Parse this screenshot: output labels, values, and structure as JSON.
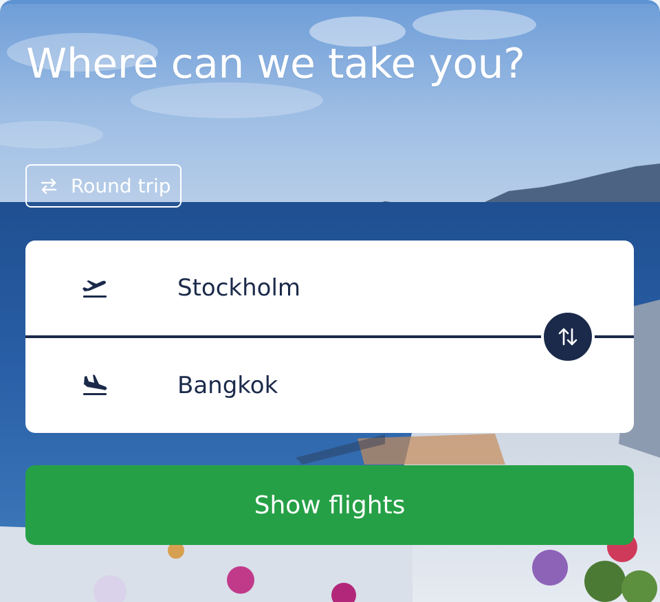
{
  "hero": {
    "title": "Where can we take you?"
  },
  "trip_type": {
    "label": "Round trip",
    "icon": "swap-horizontal-icon"
  },
  "route": {
    "origin": {
      "value": "Stockholm",
      "icon": "plane-departure-icon"
    },
    "destination": {
      "value": "Bangkok",
      "icon": "plane-arrival-icon"
    },
    "swap_icon": "swap-vertical-icon"
  },
  "cta": {
    "label": "Show flights"
  },
  "colors": {
    "brand_dark": "#1b2a4a",
    "cta_green": "#26a046",
    "white": "#ffffff"
  }
}
